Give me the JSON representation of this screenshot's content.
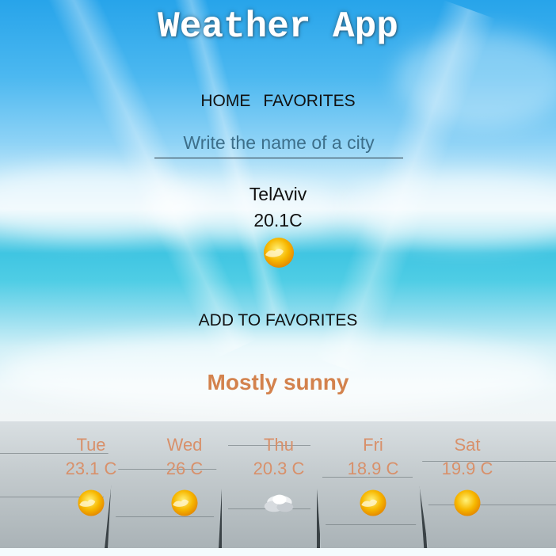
{
  "header": {
    "title": "Weather App"
  },
  "nav": {
    "home": "HOME",
    "favorites": "FAVORITES"
  },
  "search": {
    "placeholder": "Write the name of a city",
    "value": ""
  },
  "current": {
    "city": "TelAviv",
    "temperature": "20.1C",
    "icon": "partly-sunny-icon",
    "add_favorites": "ADD TO FAVORITES",
    "condition": "Mostly sunny"
  },
  "forecast": [
    {
      "day": "Tue",
      "temp": "23.1 C",
      "icon": "partly-sunny-icon"
    },
    {
      "day": "Wed",
      "temp": "26 C",
      "icon": "partly-sunny-icon"
    },
    {
      "day": "Thu",
      "temp": "20.3 C",
      "icon": "cloudy-icon"
    },
    {
      "day": "Fri",
      "temp": "18.9 C",
      "icon": "partly-sunny-icon"
    },
    {
      "day": "Sat",
      "temp": "19.9 C",
      "icon": "sunny-icon"
    }
  ],
  "colors": {
    "condition": "#d3824d",
    "forecast_text": "#d8906a",
    "sun": "#f7b800"
  }
}
